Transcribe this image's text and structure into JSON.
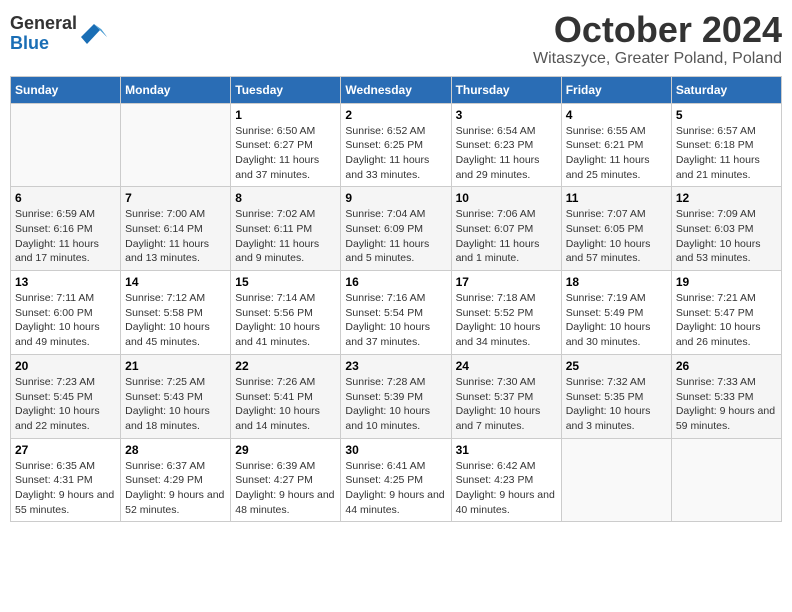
{
  "logo": {
    "general": "General",
    "blue": "Blue"
  },
  "title": "October 2024",
  "location": "Witaszyce, Greater Poland, Poland",
  "days_of_week": [
    "Sunday",
    "Monday",
    "Tuesday",
    "Wednesday",
    "Thursday",
    "Friday",
    "Saturday"
  ],
  "weeks": [
    [
      {
        "day": "",
        "info": ""
      },
      {
        "day": "",
        "info": ""
      },
      {
        "day": "1",
        "info": "Sunrise: 6:50 AM\nSunset: 6:27 PM\nDaylight: 11 hours and 37 minutes."
      },
      {
        "day": "2",
        "info": "Sunrise: 6:52 AM\nSunset: 6:25 PM\nDaylight: 11 hours and 33 minutes."
      },
      {
        "day": "3",
        "info": "Sunrise: 6:54 AM\nSunset: 6:23 PM\nDaylight: 11 hours and 29 minutes."
      },
      {
        "day": "4",
        "info": "Sunrise: 6:55 AM\nSunset: 6:21 PM\nDaylight: 11 hours and 25 minutes."
      },
      {
        "day": "5",
        "info": "Sunrise: 6:57 AM\nSunset: 6:18 PM\nDaylight: 11 hours and 21 minutes."
      }
    ],
    [
      {
        "day": "6",
        "info": "Sunrise: 6:59 AM\nSunset: 6:16 PM\nDaylight: 11 hours and 17 minutes."
      },
      {
        "day": "7",
        "info": "Sunrise: 7:00 AM\nSunset: 6:14 PM\nDaylight: 11 hours and 13 minutes."
      },
      {
        "day": "8",
        "info": "Sunrise: 7:02 AM\nSunset: 6:11 PM\nDaylight: 11 hours and 9 minutes."
      },
      {
        "day": "9",
        "info": "Sunrise: 7:04 AM\nSunset: 6:09 PM\nDaylight: 11 hours and 5 minutes."
      },
      {
        "day": "10",
        "info": "Sunrise: 7:06 AM\nSunset: 6:07 PM\nDaylight: 11 hours and 1 minute."
      },
      {
        "day": "11",
        "info": "Sunrise: 7:07 AM\nSunset: 6:05 PM\nDaylight: 10 hours and 57 minutes."
      },
      {
        "day": "12",
        "info": "Sunrise: 7:09 AM\nSunset: 6:03 PM\nDaylight: 10 hours and 53 minutes."
      }
    ],
    [
      {
        "day": "13",
        "info": "Sunrise: 7:11 AM\nSunset: 6:00 PM\nDaylight: 10 hours and 49 minutes."
      },
      {
        "day": "14",
        "info": "Sunrise: 7:12 AM\nSunset: 5:58 PM\nDaylight: 10 hours and 45 minutes."
      },
      {
        "day": "15",
        "info": "Sunrise: 7:14 AM\nSunset: 5:56 PM\nDaylight: 10 hours and 41 minutes."
      },
      {
        "day": "16",
        "info": "Sunrise: 7:16 AM\nSunset: 5:54 PM\nDaylight: 10 hours and 37 minutes."
      },
      {
        "day": "17",
        "info": "Sunrise: 7:18 AM\nSunset: 5:52 PM\nDaylight: 10 hours and 34 minutes."
      },
      {
        "day": "18",
        "info": "Sunrise: 7:19 AM\nSunset: 5:49 PM\nDaylight: 10 hours and 30 minutes."
      },
      {
        "day": "19",
        "info": "Sunrise: 7:21 AM\nSunset: 5:47 PM\nDaylight: 10 hours and 26 minutes."
      }
    ],
    [
      {
        "day": "20",
        "info": "Sunrise: 7:23 AM\nSunset: 5:45 PM\nDaylight: 10 hours and 22 minutes."
      },
      {
        "day": "21",
        "info": "Sunrise: 7:25 AM\nSunset: 5:43 PM\nDaylight: 10 hours and 18 minutes."
      },
      {
        "day": "22",
        "info": "Sunrise: 7:26 AM\nSunset: 5:41 PM\nDaylight: 10 hours and 14 minutes."
      },
      {
        "day": "23",
        "info": "Sunrise: 7:28 AM\nSunset: 5:39 PM\nDaylight: 10 hours and 10 minutes."
      },
      {
        "day": "24",
        "info": "Sunrise: 7:30 AM\nSunset: 5:37 PM\nDaylight: 10 hours and 7 minutes."
      },
      {
        "day": "25",
        "info": "Sunrise: 7:32 AM\nSunset: 5:35 PM\nDaylight: 10 hours and 3 minutes."
      },
      {
        "day": "26",
        "info": "Sunrise: 7:33 AM\nSunset: 5:33 PM\nDaylight: 9 hours and 59 minutes."
      }
    ],
    [
      {
        "day": "27",
        "info": "Sunrise: 6:35 AM\nSunset: 4:31 PM\nDaylight: 9 hours and 55 minutes."
      },
      {
        "day": "28",
        "info": "Sunrise: 6:37 AM\nSunset: 4:29 PM\nDaylight: 9 hours and 52 minutes."
      },
      {
        "day": "29",
        "info": "Sunrise: 6:39 AM\nSunset: 4:27 PM\nDaylight: 9 hours and 48 minutes."
      },
      {
        "day": "30",
        "info": "Sunrise: 6:41 AM\nSunset: 4:25 PM\nDaylight: 9 hours and 44 minutes."
      },
      {
        "day": "31",
        "info": "Sunrise: 6:42 AM\nSunset: 4:23 PM\nDaylight: 9 hours and 40 minutes."
      },
      {
        "day": "",
        "info": ""
      },
      {
        "day": "",
        "info": ""
      }
    ]
  ]
}
